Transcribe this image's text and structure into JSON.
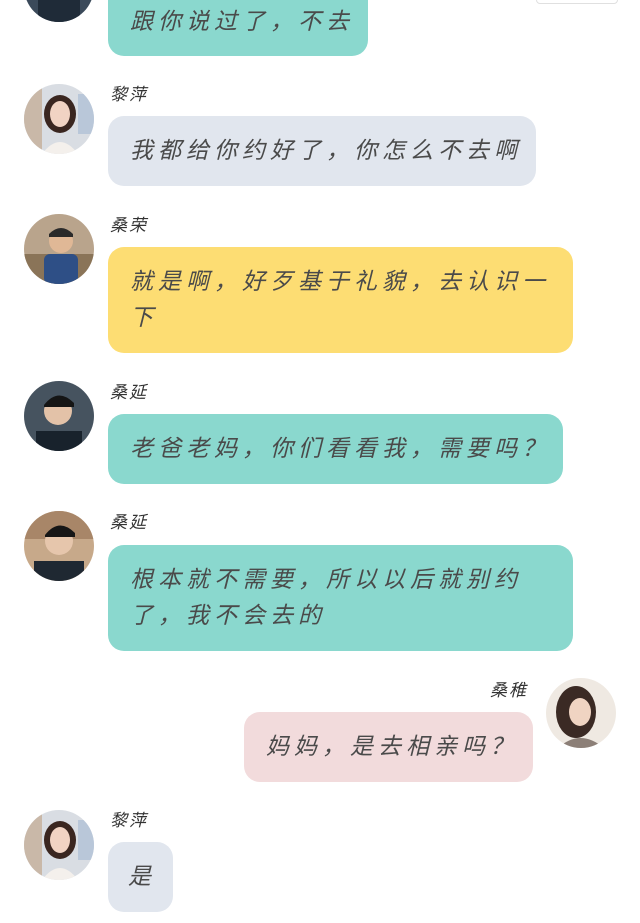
{
  "messages": [
    {
      "sender": "",
      "text": "跟你说过了，不去",
      "color": "#8ad8ce"
    },
    {
      "sender": "黎萍",
      "text": "我都给你约好了，你怎么不去啊",
      "color": "#e1e6ee"
    },
    {
      "sender": "桑荣",
      "text": "就是啊，好歹基于礼貌，去认识一下",
      "color": "#fddd73"
    },
    {
      "sender": "桑延",
      "text": "老爸老妈，你们看看我，需要吗？",
      "color": "#8ad8ce"
    },
    {
      "sender": "桑延",
      "text": "根本就不需要，所以以后就别约了，我不会去的",
      "color": "#8ad8ce"
    },
    {
      "sender": "桑稚",
      "text": "妈妈，是去相亲吗？",
      "color": "#f2dbdc"
    },
    {
      "sender": "黎萍",
      "text": "是",
      "color": "#e1e6ee"
    }
  ]
}
